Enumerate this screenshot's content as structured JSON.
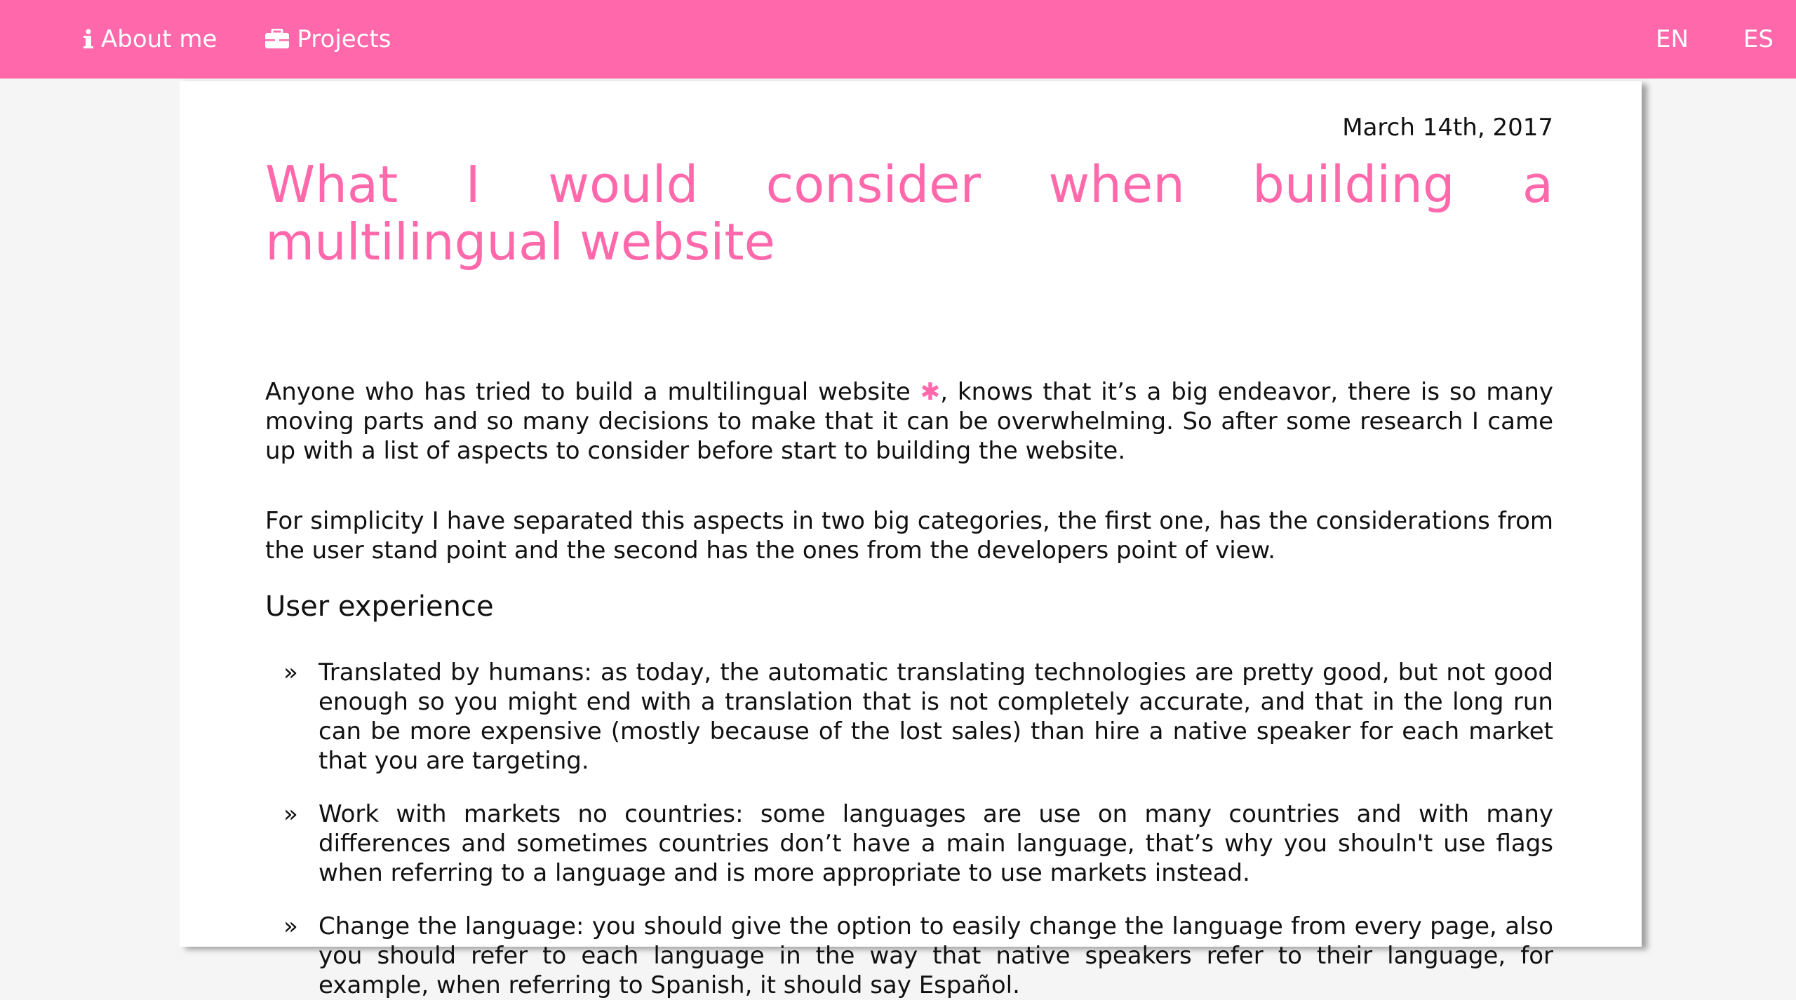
{
  "nav": {
    "about_label": "About me",
    "projects_label": "Projects",
    "lang_en": "EN",
    "lang_es": "ES",
    "about_icon": "info-icon",
    "projects_icon": "briefcase-icon"
  },
  "colors": {
    "accent": "#ff69ab",
    "background": "#f5f5f5",
    "card": "#ffffff"
  },
  "article": {
    "date": "March 14th, 2017",
    "title": "What I would consider when building a multilingual website",
    "p1_before": "Anyone who has tried to build a multilingual website ",
    "p1_asterisk": "✱",
    "p1_after": ", knows that it’s a big endeavor, there is so many moving parts and so many decisions to make that it can be overwhelming. So after some research I came up with a list of aspects to consider before start to building the website.",
    "p2": "For simplicity I have separated this aspects in two big categories, the first one, has the considerations from the user stand point and the second has the ones from the developers point of view.",
    "section_heading": "User experience",
    "bullet_glyph": "»",
    "items": [
      "Translated by humans: as today, the automatic translating technologies are pretty good, but not good enough so you might end with a translation that is not completely accurate, and that in the long run can be more expensive (mostly because of the lost sales) than hire a native speaker for each market that you are targeting.",
      "Work with markets no countries: some languages are use on many countries and with many differences and sometimes countries don’t have a main language, that’s why you shouln't use flags when referring to a language and is more appropriate to use markets instead.",
      "Change the language: you should give the option to easily change the language from every page, also you should refer to each language in the way that native speakers refer to their language, for example, when referring to Spanish, it should say Español."
    ]
  }
}
